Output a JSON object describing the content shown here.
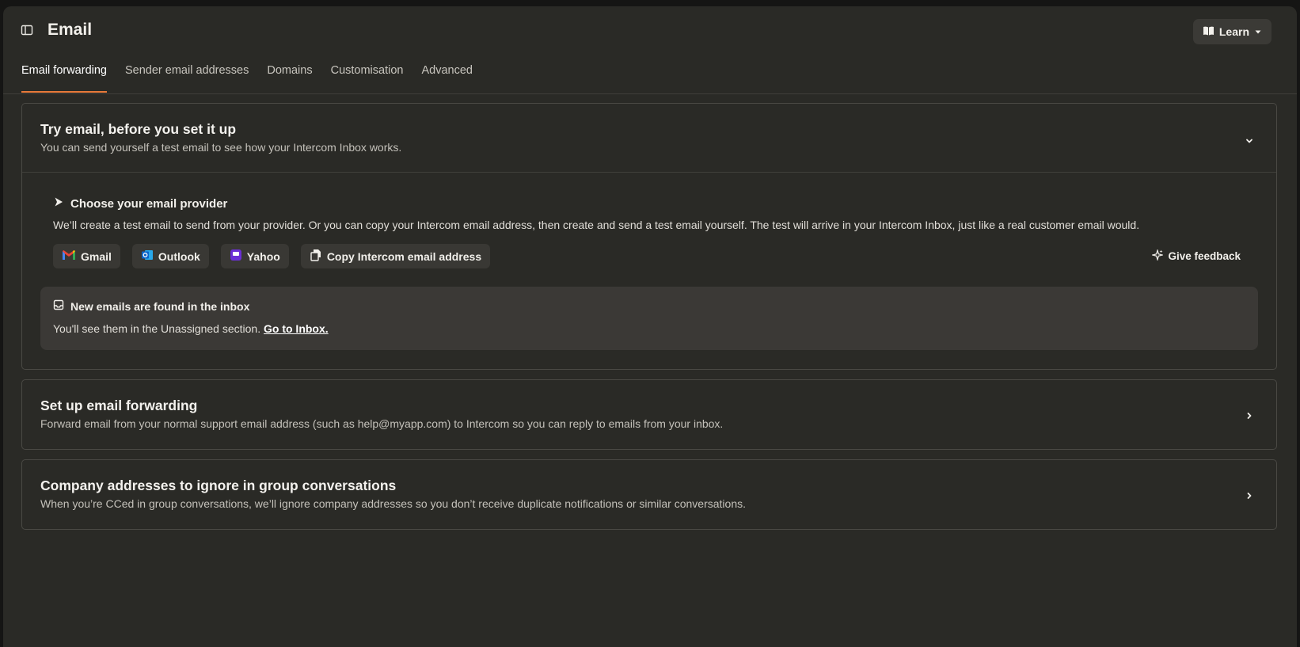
{
  "header": {
    "title": "Email",
    "learn_label": "Learn"
  },
  "tabs": [
    {
      "label": "Email forwarding",
      "active": true
    },
    {
      "label": "Sender email addresses"
    },
    {
      "label": "Domains"
    },
    {
      "label": "Customisation"
    },
    {
      "label": "Advanced"
    }
  ],
  "try_email": {
    "title": "Try email, before you set it up",
    "description": "You can send yourself a test email to see how your Intercom Inbox works.",
    "provider_title": "Choose your email provider",
    "provider_description": "We’ll create a test email to send from your provider. Or you can copy your Intercom email address, then create and send a test email yourself. The test will arrive in your Intercom Inbox, just like a real customer email would.",
    "buttons": {
      "gmail": "Gmail",
      "outlook": "Outlook",
      "yahoo": "Yahoo",
      "copy": "Copy Intercom email address"
    },
    "feedback_label": "Give feedback",
    "notice": {
      "title": "New emails are found in the inbox",
      "text": "You'll see them in the Unassigned section.",
      "link": "Go to Inbox."
    }
  },
  "forwarding": {
    "title": "Set up email forwarding",
    "description": "Forward email from your normal support email address (such as help@myapp.com) to Intercom so you can reply to emails from your inbox."
  },
  "ignore": {
    "title": "Company addresses to ignore in group conversations",
    "description": "When you’re CCed in group conversations, we’ll ignore company addresses so you don’t receive duplicate notifications or similar conversations."
  },
  "icons": {
    "sidebar_toggle": "sidebar-toggle-icon",
    "learn": "book-icon",
    "caret": "caret-down-icon",
    "provider": "play-arrow-icon",
    "gmail": "gmail-icon",
    "outlook": "outlook-icon",
    "yahoo": "yahoo-icon",
    "copy": "copy-icon",
    "feedback": "sparkle-icon",
    "inbox": "inbox-icon",
    "chevron_down": "chevron-down-icon",
    "chevron_right": "chevron-right-icon"
  },
  "colors": {
    "accent": "#e8793a",
    "gmail_red": "#ea4335",
    "outlook_blue": "#0a64c8",
    "yahoo_purple": "#6b2fd6"
  }
}
